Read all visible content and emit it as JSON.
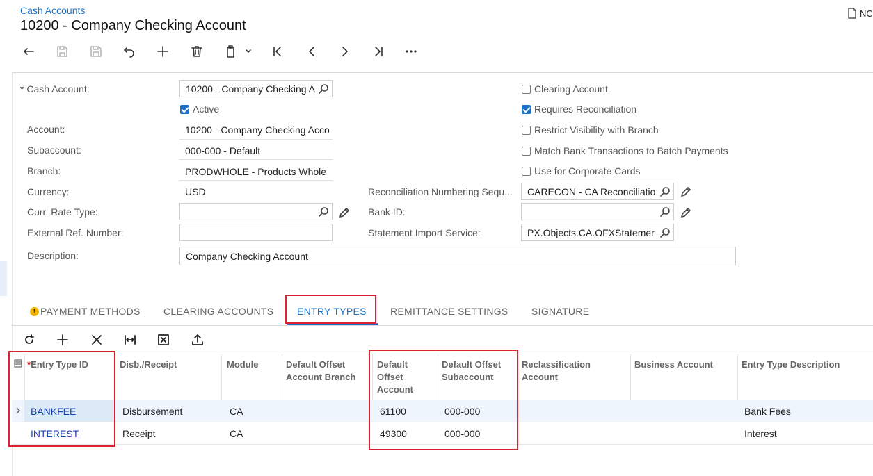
{
  "breadcrumb": "Cash Accounts",
  "title": "10200 - Company Checking Account",
  "top_right_label": "NC",
  "toolbar": [
    "back-icon",
    "save-close-icon",
    "save-icon",
    "undo-icon",
    "add-icon",
    "delete-icon",
    "copy-paste-icon",
    "first-record-icon",
    "previous-icon",
    "next-icon",
    "last-record-icon",
    "more-icon"
  ],
  "form": {
    "cash_account": {
      "label": "Cash Account:",
      "required_mark": "*",
      "value": "10200 - Company Checking A"
    },
    "active": {
      "label": "Active",
      "checked": true
    },
    "account": {
      "label": "Account:",
      "value": "10200 - Company Checking Acco"
    },
    "subaccount": {
      "label": "Subaccount:",
      "value": "000-000 - Default"
    },
    "branch": {
      "label": "Branch:",
      "value": "PRODWHOLE - Products Whole"
    },
    "currency": {
      "label": "Currency:",
      "value": "USD"
    },
    "curr_rate_type": {
      "label": "Curr. Rate Type:",
      "value": ""
    },
    "external_ref": {
      "label": "External Ref. Number:",
      "value": ""
    },
    "description": {
      "label": "Description:",
      "value": "Company Checking Account"
    },
    "clearing_account": {
      "label": "Clearing Account",
      "checked": false
    },
    "requires_reconciliation": {
      "label": "Requires Reconciliation",
      "checked": true
    },
    "restrict_visibility": {
      "label": "Restrict Visibility with Branch",
      "checked": false
    },
    "match_bank": {
      "label": "Match Bank Transactions to Batch Payments",
      "checked": false
    },
    "corporate_cards": {
      "label": "Use for Corporate Cards",
      "checked": false
    },
    "recon_numbering": {
      "label": "Reconciliation Numbering Sequ...",
      "value": "CARECON - CA Reconciliatio"
    },
    "bank_id": {
      "label": "Bank ID:",
      "value": ""
    },
    "statement_import": {
      "label": "Statement Import Service:",
      "value": "PX.Objects.CA.OFXStatemer"
    }
  },
  "tabs": [
    {
      "label": "PAYMENT METHODS",
      "warning": "!"
    },
    {
      "label": "CLEARING ACCOUNTS"
    },
    {
      "label": "ENTRY TYPES",
      "active": true
    },
    {
      "label": "REMITTANCE SETTINGS"
    },
    {
      "label": "SIGNATURE"
    }
  ],
  "grid_toolbar": [
    "refresh-icon",
    "add-row-icon",
    "delete-row-icon",
    "fit-columns-icon",
    "export-excel-icon",
    "upload-icon"
  ],
  "grid": {
    "required_mark": "*",
    "headers": {
      "entry_type_id": "Entry Type ID",
      "disb_receipt": "Disb./Receipt",
      "module": "Module",
      "offset_branch": "Default Offset Account Branch",
      "offset_account": "Default Offset Account",
      "offset_subaccount": "Default Offset Subaccount",
      "reclass_account": "Reclassification Account",
      "business_account": "Business Account",
      "description": "Entry Type Description"
    },
    "rows": [
      {
        "entry_type_id": "BANKFEE",
        "disb_receipt": "Disbursement",
        "module": "CA",
        "offset_branch": "",
        "offset_account": "61100",
        "offset_subaccount": "000-000",
        "reclass_account": "",
        "business_account": "",
        "description": "Bank Fees"
      },
      {
        "entry_type_id": "INTEREST",
        "disb_receipt": "Receipt",
        "module": "CA",
        "offset_branch": "",
        "offset_account": "49300",
        "offset_subaccount": "000-000",
        "reclass_account": "",
        "business_account": "",
        "description": "Interest"
      }
    ]
  },
  "colors": {
    "accent": "#1a73c8",
    "highlight": "#d9232e",
    "selected_row": "#dceaf7",
    "link": "#1a3fb0"
  }
}
